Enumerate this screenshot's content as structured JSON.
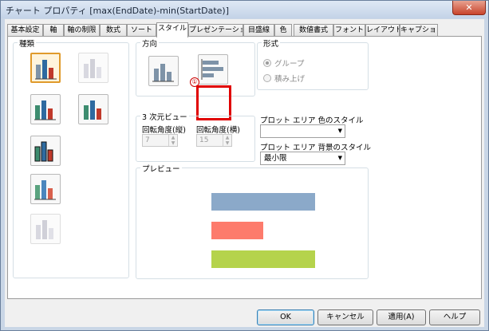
{
  "window": {
    "title": "チャート プロパティ [max(EndDate)-min(StartDate)]",
    "close_label": "✕"
  },
  "tabs": [
    {
      "label": "基本設定"
    },
    {
      "label": "軸"
    },
    {
      "label": "軸の制限"
    },
    {
      "label": "数式"
    },
    {
      "label": "ソート"
    },
    {
      "label": "スタイル"
    },
    {
      "label": "プレゼンテーション"
    },
    {
      "label": "目盛線"
    },
    {
      "label": "色"
    },
    {
      "label": "数値書式"
    },
    {
      "label": "フォント"
    },
    {
      "label": "レイアウト"
    },
    {
      "label": "キャプション"
    }
  ],
  "active_tab": "スタイル",
  "type_group": {
    "label": "種類"
  },
  "direction_group": {
    "label": "方向"
  },
  "annotation": {
    "label": "①"
  },
  "form_group": {
    "label": "形式",
    "options": [
      {
        "label": "グループ",
        "selected": true
      },
      {
        "label": "積み上げ",
        "selected": false
      }
    ]
  },
  "view3d_group": {
    "label": "3 次元ビュー",
    "vertical_label": "回転角度(縦)",
    "vertical_value": "7",
    "horizontal_label": "回転角度(横)",
    "horizontal_value": "15"
  },
  "plot_color_label": "プロット エリア 色のスタイル",
  "plot_color_value": "",
  "plot_bg_label": "プロット エリア 背景のスタイル",
  "plot_bg_value": "最小限",
  "preview_group": {
    "label": "プレビュー"
  },
  "preview_bars": [
    {
      "value": 1.0,
      "color": "#8ba9c9"
    },
    {
      "value": 0.5,
      "color": "#fd7b6c"
    },
    {
      "value": 1.0,
      "color": "#b5d34c"
    }
  ],
  "buttons": {
    "ok": "OK",
    "cancel": "キャンセル",
    "apply": "適用(A)",
    "help": "ヘルプ"
  },
  "colors": {
    "selected_border": "#e09a2b",
    "annotation_red": "#e00000"
  }
}
